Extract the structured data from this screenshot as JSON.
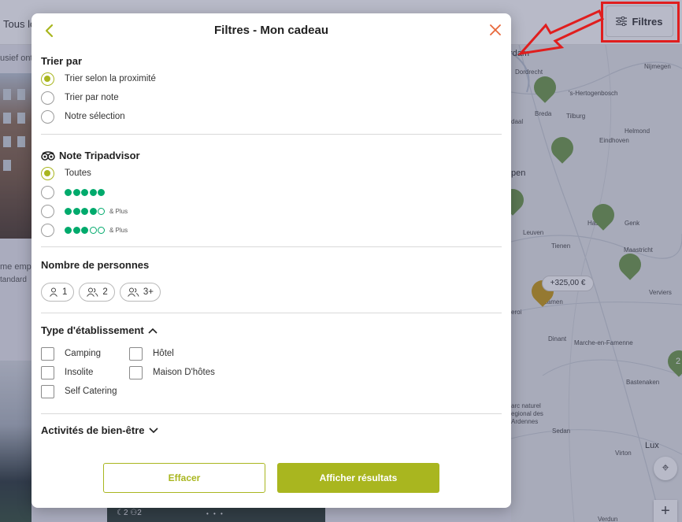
{
  "background": {
    "tous_label": "Tous lo",
    "desc_text": "usief ont",
    "emp_text": "me emp",
    "std_text": "tandard",
    "filters_button_label": "Filtres",
    "price_tag": "+325,00 €",
    "map_cities": {
      "dam": "rdam",
      "dordrecht": "Dordrecht",
      "nijmegen": "Nijmegen",
      "hertogenbosch": "'s-Hertogenbosch",
      "breda": "Breda",
      "tilburg": "Tilburg",
      "daal": "daal",
      "helmond": "Helmond",
      "eindhoven": "Eindhoven",
      "pen": "pen",
      "leuven": "Leuven",
      "hasselt": "Hasselt",
      "genk": "Genk",
      "tienen": "Tienen",
      "maastricht": "Maastricht",
      "verviers": "Verviers",
      "namen": "Namen",
      "eroi": "eroi",
      "dinant": "Dinant",
      "marche": "Marche-en-Famenne",
      "bastenaken": "Bastenaken",
      "parc": "arc naturel\negional des\nArdennes",
      "sedan": "Sedan",
      "virton": "Virton",
      "lux": "Lux",
      "verdun": "Verdun"
    },
    "map_cluster_label": "2"
  },
  "modal": {
    "title": "Filtres - Mon cadeau",
    "sort": {
      "title": "Trier par",
      "options": [
        "Trier selon la proximité",
        "Trier par note",
        "Notre sélection"
      ],
      "selected_index": 0
    },
    "tripadvisor": {
      "title": "Note Tripadvisor",
      "options": [
        {
          "label": "Toutes",
          "filled": 0,
          "plus": ""
        },
        {
          "label": "",
          "filled": 5,
          "plus": ""
        },
        {
          "label": "",
          "filled": 4,
          "plus": "& Plus"
        },
        {
          "label": "",
          "filled": 3,
          "plus": "& Plus"
        }
      ],
      "selected_index": 0,
      "bubble_color": "#00aa6c"
    },
    "people": {
      "title": "Nombre de personnes",
      "options": [
        "1",
        "2",
        "3+"
      ]
    },
    "type": {
      "title": "Type d'établissement",
      "expanded": true,
      "options": [
        "Camping",
        "Hôtel",
        "Insolite",
        "Maison D'hôtes",
        "Self Catering"
      ]
    },
    "activities": {
      "title": "Activités de bien-être",
      "expanded": false
    },
    "buttons": {
      "clear": "Effacer",
      "apply": "Afficher résultats"
    },
    "accent_color": "#a9b61f",
    "close_color": "#e8673a"
  },
  "annotation": {
    "highlight_color": "#e01e1e"
  }
}
